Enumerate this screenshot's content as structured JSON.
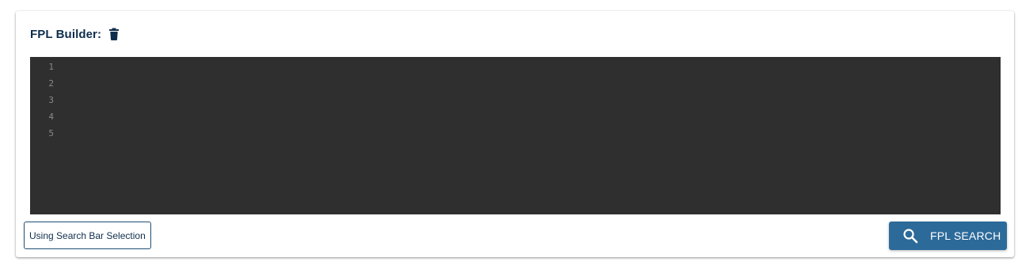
{
  "builder": {
    "title": "FPL Builder:",
    "delete_icon": "trash-icon"
  },
  "editor": {
    "line_numbers": [
      "1",
      "2",
      "3",
      "4",
      "5"
    ]
  },
  "actions": {
    "scope_label": "Using Search Bar Selection",
    "search_label": "FPL SEARCH",
    "search_icon": "search-icon"
  },
  "colors": {
    "title": "#0f2e4d",
    "editor_background": "#2f2f2f",
    "primary_button": "#2c6a9a"
  }
}
